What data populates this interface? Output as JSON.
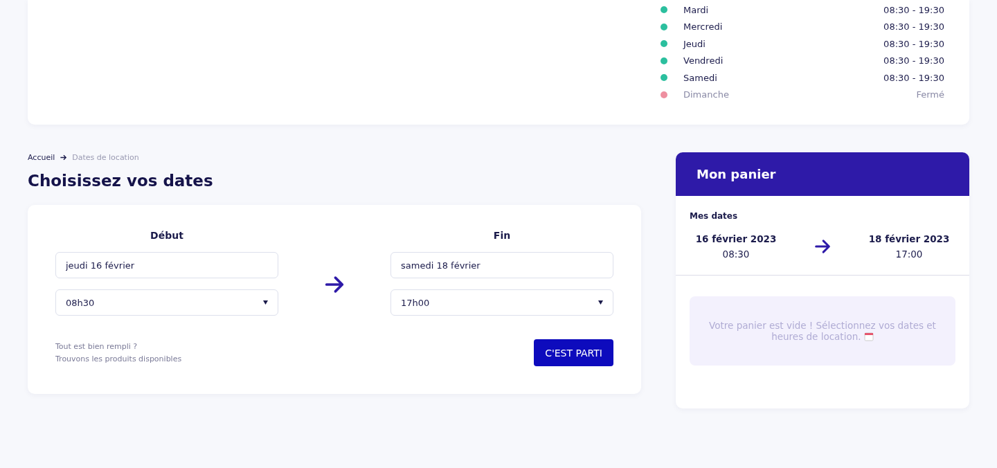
{
  "hours": [
    {
      "day": "Mardi",
      "time": "08:30 - 19:30",
      "open": true
    },
    {
      "day": "Mercredi",
      "time": "08:30 - 19:30",
      "open": true
    },
    {
      "day": "Jeudi",
      "time": "08:30 - 19:30",
      "open": true
    },
    {
      "day": "Vendredi",
      "time": "08:30 - 19:30",
      "open": true
    },
    {
      "day": "Samedi",
      "time": "08:30 - 19:30",
      "open": true
    },
    {
      "day": "Dimanche",
      "time": "Fermé",
      "open": false
    }
  ],
  "breadcrumb": [
    {
      "label": "Accueil",
      "current": false
    },
    {
      "label": "Dates de location",
      "current": true
    }
  ],
  "title": "Choisissez vos dates",
  "form": {
    "start": {
      "label": "Début",
      "date": "jeudi 16 février",
      "time": "08h30"
    },
    "end": {
      "label": "Fin",
      "date": "samedi 18 février",
      "time": "17h00"
    },
    "hint": [
      "Tout est bien rempli ?",
      "Trouvons les produits disponibles"
    ],
    "submit": "C'EST PARTI"
  },
  "cart": {
    "title": "Mon panier",
    "dates_label": "Mes dates",
    "start": {
      "date": "16 février 2023",
      "time": "08:30"
    },
    "end": {
      "date": "18 février 2023",
      "time": "17:00"
    },
    "empty_message": "Votre panier est vide ! Sélectionnez vos dates et heures de location."
  }
}
